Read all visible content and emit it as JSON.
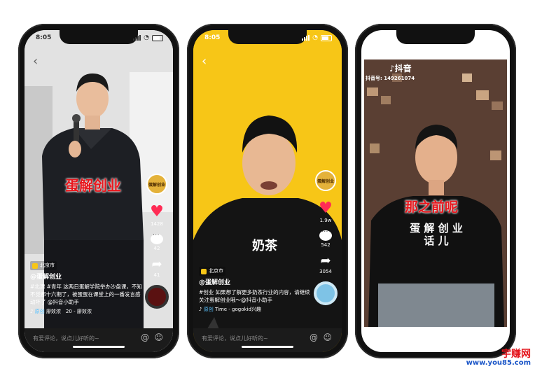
{
  "phone1": {
    "time": "8:05",
    "caption": "蛋解创业",
    "avatar_text": "蛋解创业",
    "likes": "1428",
    "comments": "42",
    "shares": "41",
    "location": "北京市",
    "author": "@蛋解创业",
    "description": "#北漂 #青年 这两日蛋解学院举办沙盘课，不知不觉都十六期了，被蛋蛋在课堂上的一番发言感动坏了 @抖音小助手",
    "music_tag": "原创",
    "music_text": "廖效浓　20 - 廖效浓",
    "comment_placeholder": "有爱评论，说点儿好听的~"
  },
  "phone2": {
    "time": "8:05",
    "shirt_text": "奶茶",
    "avatar_text": "蛋解创业",
    "likes": "1.9w",
    "comments": "542",
    "shares": "3054",
    "location": "北京市",
    "author": "@蛋解创业",
    "description": "#创业 如果想了解更多奶茶行业的内容，请继续关注蛋解创业哦～@抖音小助手",
    "music_tag": "原创",
    "music_text": "Time - gogokid兴趣",
    "comment_placeholder": "有爱评论，说点儿好听的~"
  },
  "phone3": {
    "logo_text": "抖音",
    "account_id": "抖音号: 149261074",
    "caption": "那之前呢",
    "shirt_text": "蛋 解 创 业 话 儿"
  },
  "watermark": {
    "line1": "宇赚网",
    "line2": "www.you85.com"
  },
  "colors": {
    "caption_red": "#e8161c",
    "like_pink": "#ff2c55",
    "yellow_bg": "#f7c617"
  }
}
